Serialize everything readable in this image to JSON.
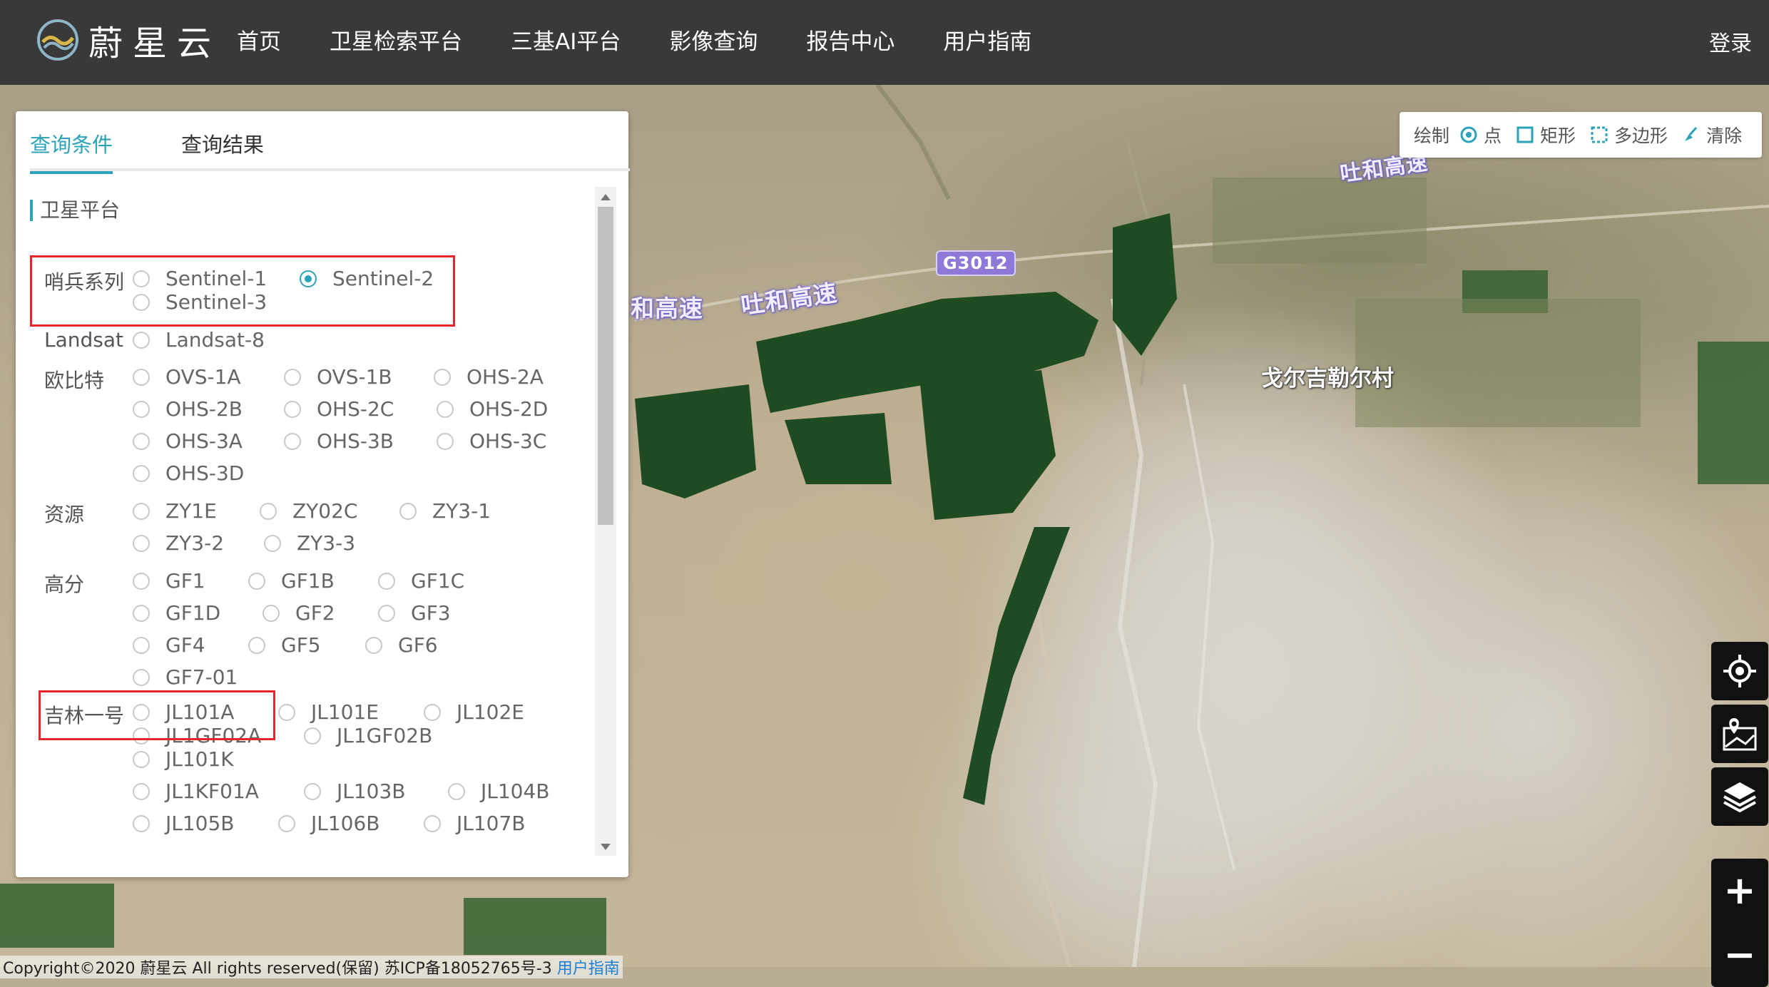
{
  "header": {
    "logo_text": "蔚星云",
    "nav": [
      "首页",
      "卫星检索平台",
      "三基AI平台",
      "影像查询",
      "报告中心",
      "用户指南"
    ],
    "login": "登录"
  },
  "panel": {
    "tabs": [
      "查询条件",
      "查询结果"
    ],
    "active_tab": 0,
    "section_title": "卫星平台",
    "groups": {
      "sentinel": {
        "label": "哨兵系列",
        "options": [
          "Sentinel-1",
          "Sentinel-2",
          "Sentinel-3"
        ],
        "selected": "Sentinel-2"
      },
      "landsat": {
        "label": "Landsat",
        "options": [
          "Landsat-8"
        ]
      },
      "ovs": {
        "label": "欧比特",
        "options": [
          "OVS-1A",
          "OVS-1B",
          "OHS-2A",
          "OHS-2B",
          "OHS-2C",
          "OHS-2D",
          "OHS-3A",
          "OHS-3B",
          "OHS-3C",
          "OHS-3D"
        ]
      },
      "zy": {
        "label": "资源",
        "options": [
          "ZY1E",
          "ZY02C",
          "ZY3-1",
          "ZY3-2",
          "ZY3-3"
        ]
      },
      "gf": {
        "label": "高分",
        "options": [
          "GF1",
          "GF1B",
          "GF1C",
          "GF1D",
          "GF2",
          "GF3",
          "GF4",
          "GF5",
          "GF6",
          "GF7-01"
        ]
      },
      "jl": {
        "label": "吉林一号",
        "options": [
          "JL101A",
          "JL101E",
          "JL102E",
          "JL1GF02A",
          "JL1GF02B",
          "JL101K",
          "JL1KF01A",
          "JL103B",
          "JL104B",
          "JL105B",
          "JL106B",
          "JL107B"
        ]
      }
    }
  },
  "map": {
    "draw_toolbar": {
      "label": "绘制",
      "point": "点",
      "rect": "矩形",
      "polygon": "多边形",
      "clear": "清除"
    },
    "labels": {
      "road1": "吐和高速",
      "road2": "和高速",
      "road3": "吐和高速",
      "shield": "G3012",
      "place": "戈尔吉勒尔村"
    },
    "controls": {
      "zoom_in": "+",
      "zoom_out": "−"
    },
    "copyright": "Copyright©2020 蔚星云 All rights reserved(保留) 苏ICP备18052765号-3",
    "copyright_link": "用户指南"
  },
  "colors": {
    "accent": "#2aa2b8",
    "nav_bg": "#393939",
    "highlight": "#e8252d"
  }
}
